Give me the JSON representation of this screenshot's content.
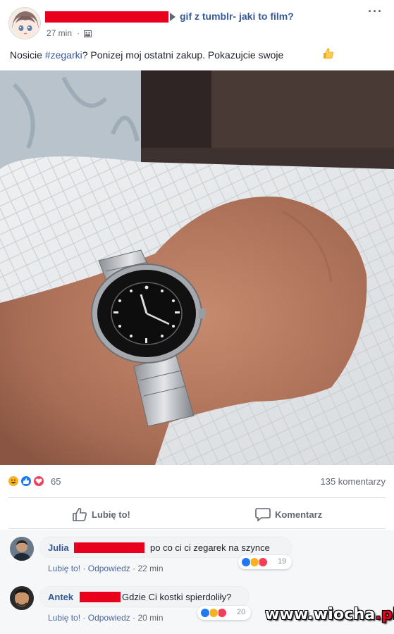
{
  "post": {
    "group_name": "gif z tumblr- jaki to film?",
    "time": "27 min",
    "dot": "·",
    "text_before": "Nosicie ",
    "hashtag": "#zegarki",
    "text_after": "? Ponizej moj ostatni zakup. Pokazujcie swoje",
    "more_label": "···"
  },
  "reactions": {
    "types": [
      "haha",
      "like",
      "love"
    ],
    "count": "65",
    "comments_count": "135 komentarzy"
  },
  "actions": {
    "like_label": "Lubię to!",
    "comment_label": "Komentarz"
  },
  "comments": [
    {
      "name": "Julia",
      "text": "po co ci ci zegarek na szynce",
      "like_link": "Lubię to!",
      "reply_link": "Odpowiedz",
      "time": "22 min",
      "reaction_count": "19",
      "reaction_types": [
        "like",
        "haha",
        "love"
      ]
    },
    {
      "name": "Antek",
      "text": "Gdzie Ci kostki spierdoliły?",
      "like_link": "Lubię to!",
      "reply_link": "Odpowiedz",
      "time": "20 min",
      "reaction_count": "20",
      "reaction_types": [
        "like",
        "haha",
        "love"
      ]
    }
  ],
  "watermark": {
    "main": "www.wiocha",
    "tld": ".pl"
  },
  "colors": {
    "link": "#365899",
    "redaction": "#e8001c",
    "like_blue": "#2078f4",
    "love_red": "#f33e58",
    "haha_yellow": "#f7b125"
  }
}
